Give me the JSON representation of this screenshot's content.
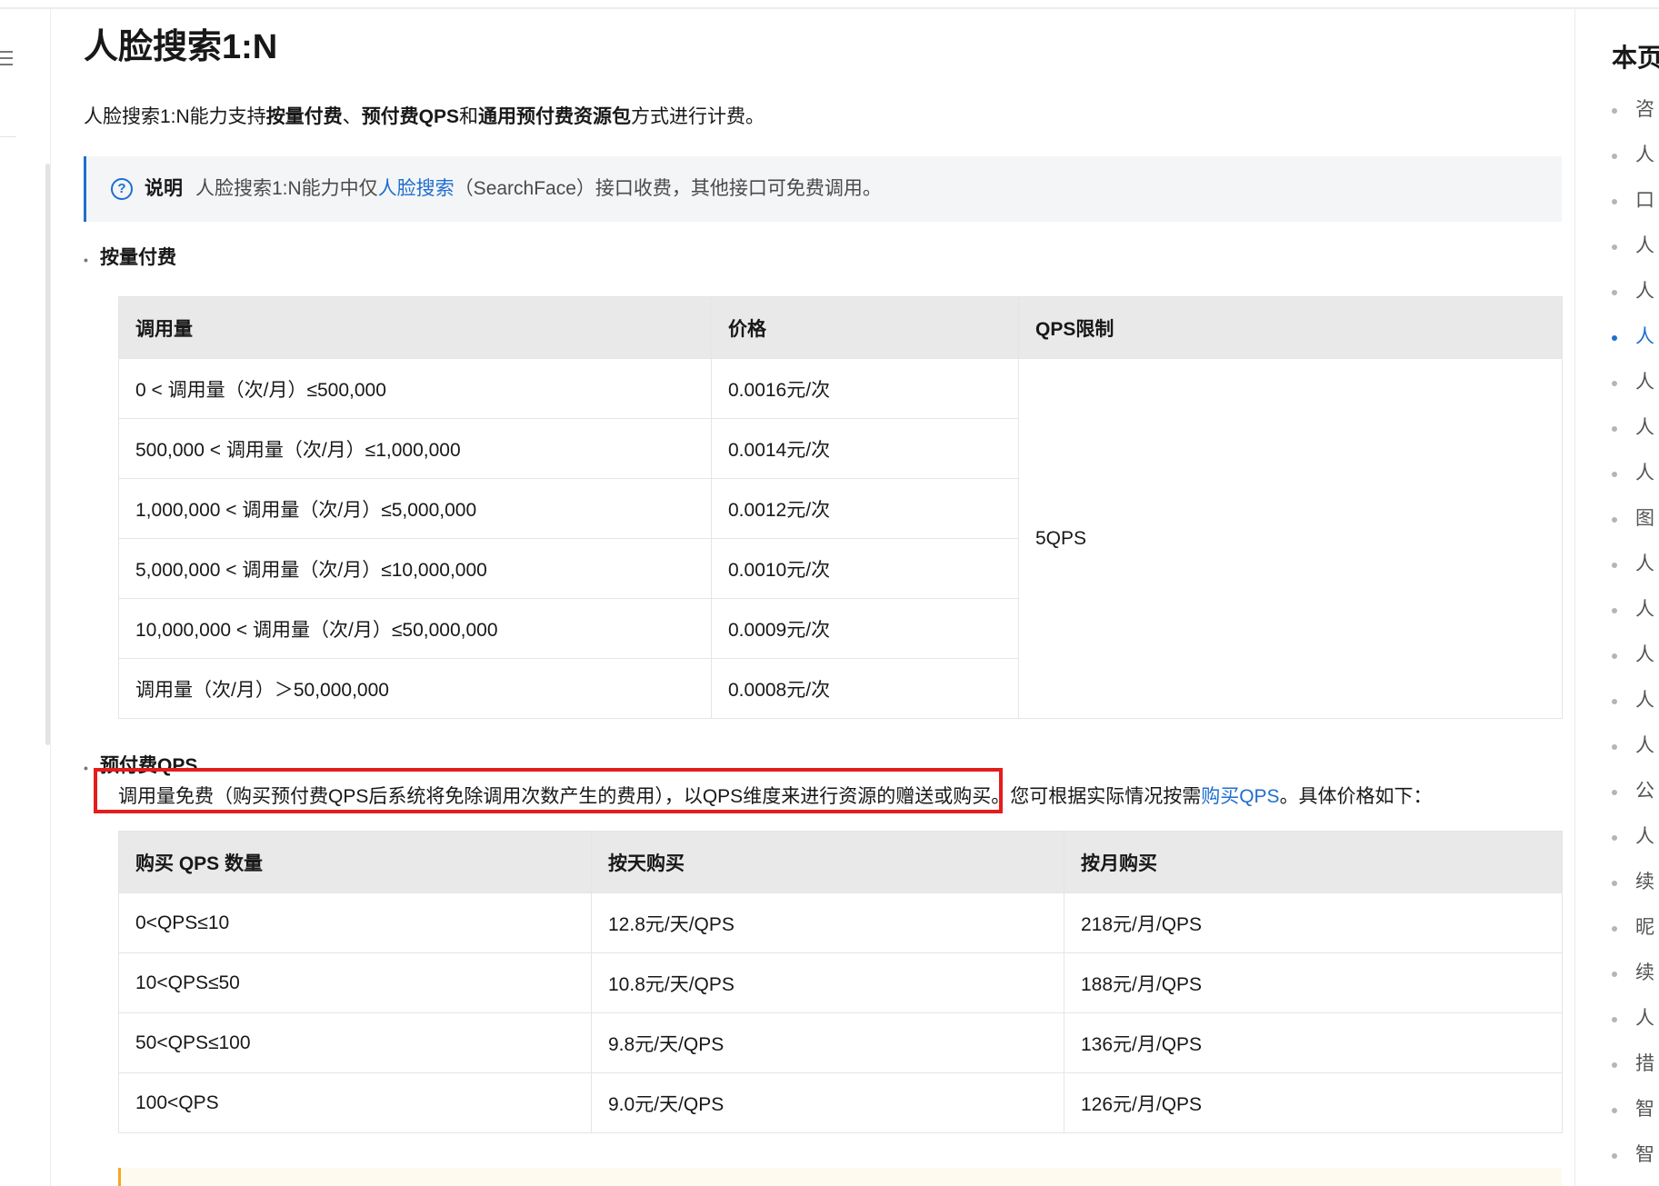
{
  "page": {
    "title": "人脸搜索1:N",
    "intro": {
      "t1": "人脸搜索1:N能力支持",
      "b1": "按量付费",
      "t2": "、",
      "b2": "预付费QPS",
      "t3": "和",
      "b3": "通用预付费资源包",
      "t4": "方式进行计费。"
    },
    "note": {
      "icon": "help-circle-icon",
      "title": "说明",
      "text_before": "人脸搜索1:N能力中仅",
      "link": "人脸搜索",
      "text_after": "（SearchFace）接口收费，其他接口可免费调用。"
    }
  },
  "pay_as_you_go": {
    "heading": "按量付费",
    "headers": [
      "调用量",
      "价格",
      "QPS限制"
    ],
    "rows": [
      {
        "range": "0 < 调用量（次/月）≤500,000",
        "price": "0.0016元/次"
      },
      {
        "range": "500,000 < 调用量（次/月）≤1,000,000",
        "price": "0.0014元/次"
      },
      {
        "range": "1,000,000 < 调用量（次/月）≤5,000,000",
        "price": "0.0012元/次"
      },
      {
        "range": "5,000,000 < 调用量（次/月）≤10,000,000",
        "price": "0.0010元/次"
      },
      {
        "range": "10,000,000 < 调用量（次/月）≤50,000,000",
        "price": "0.0009元/次"
      },
      {
        "range": "调用量（次/月）＞50,000,000",
        "price": "0.0008元/次"
      }
    ],
    "qps_limit": "5QPS"
  },
  "prepaid_qps": {
    "heading": "预付费QPS",
    "desc_highlight": "调用量免费（购买预付费QPS后系统将免除调用次数产生的费用），以QPS维度来进行资源的赠送或购买。",
    "desc_rest": "您可根据实际情况按需",
    "desc_link": "购买QPS",
    "desc_end": "。具体价格如下：",
    "headers": [
      "购买 QPS 数量",
      "按天购买",
      "按月购买"
    ],
    "rows": [
      {
        "qty": "0<QPS≤10",
        "day": "12.8元/天/QPS",
        "month": "218元/月/QPS"
      },
      {
        "qty": "10<QPS≤50",
        "day": "10.8元/天/QPS",
        "month": "188元/月/QPS"
      },
      {
        "qty": "50<QPS≤100",
        "day": "9.8元/天/QPS",
        "month": "136元/月/QPS"
      },
      {
        "qty": "100<QPS",
        "day": "9.0元/天/QPS",
        "month": "126元/月/QPS"
      }
    ]
  },
  "toc": {
    "title": "本页",
    "items": [
      "咨",
      "人",
      "口",
      "人",
      "人",
      "人",
      "人",
      "人",
      "人",
      "图",
      "人",
      "人",
      "人",
      "人",
      "人",
      "公",
      "人",
      "续",
      "昵",
      "续",
      "人",
      "措",
      "智",
      "智"
    ],
    "active_index": 5
  },
  "colors": {
    "accent": "#1f6ecf",
    "highlight_border": "#e41c1c",
    "table_header_bg": "#e9e9e9",
    "note_bg": "#f4f5f7"
  }
}
